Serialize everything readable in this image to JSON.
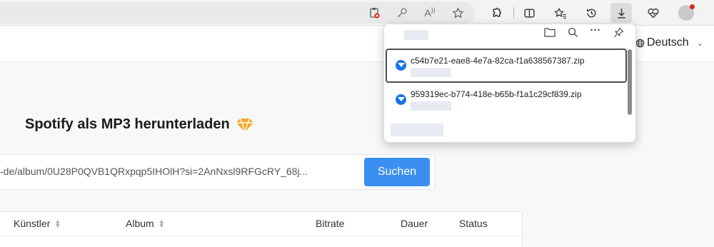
{
  "browser": {
    "toolbar_icons": [
      {
        "name": "clipboard-alert-icon",
        "glyph": "📋"
      },
      {
        "name": "key-icon",
        "glyph": "⚷"
      },
      {
        "name": "read-aloud-icon",
        "glyph": "A"
      },
      {
        "name": "favorite-star-icon",
        "glyph": "☆"
      },
      {
        "name": "extensions-icon",
        "glyph": "⧉"
      },
      {
        "name": "split-screen-icon",
        "glyph": "▯"
      },
      {
        "name": "favorites-icon",
        "glyph": "☆"
      },
      {
        "name": "history-icon",
        "glyph": "↺"
      },
      {
        "name": "downloads-icon",
        "glyph": "⤓"
      },
      {
        "name": "health-heart-icon",
        "glyph": "♡"
      }
    ]
  },
  "header": {
    "language_label": "Deutsch"
  },
  "main": {
    "title": "Spotify als MP3 herunterladen",
    "search_value": "-de/album/0U28P0QVB1QRxpqp5IHOlH?si=2AnNxsl9RFGcRY_68j...",
    "search_button": "Suchen"
  },
  "table": {
    "columns": [
      "Künstler",
      "Album",
      "Bitrate",
      "Dauer",
      "Status"
    ]
  },
  "downloads": {
    "items": [
      {
        "file_name": "c54b7e21-eae8-4e7a-82ca-f1a638567387.zip"
      },
      {
        "file_name": "959319ec-b774-418e-b65b-f1a1c29cf839.zip"
      }
    ]
  },
  "colors": {
    "accent": "#3b8ff0",
    "gem": "#f5a623",
    "notification_dot": "#e0241b"
  }
}
